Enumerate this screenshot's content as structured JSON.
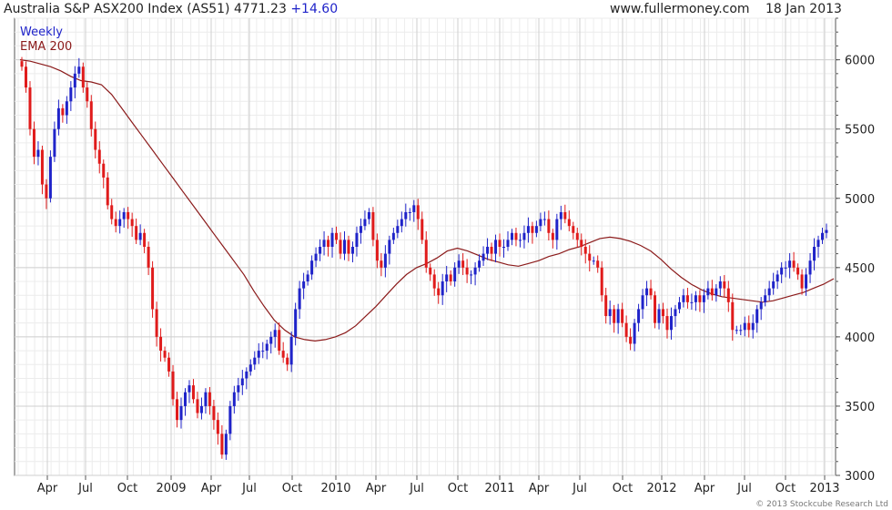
{
  "header": {
    "instrument": "Australia S&P ASX200 Index (AS51)",
    "last": "4771.23",
    "change": "+14.60",
    "site": "www.fullermoney.com",
    "date": "18 Jan 2013"
  },
  "copyright": "© 2013 Stockcube Research Ltd",
  "colors": {
    "up": "#1f23c9",
    "down": "#e01b1b",
    "ema": "#8b1a1a",
    "grid": "#cfcfcf",
    "change": "#1f23c9"
  },
  "chart_data": {
    "type": "candlestick",
    "period": "Weekly",
    "title": "Australia S&P ASX200 Index (AS51)",
    "ylim": [
      3000,
      6300
    ],
    "y_ticks": [
      3000,
      3500,
      4000,
      4500,
      5000,
      5500,
      6000
    ],
    "x_ticks": [
      "Apr",
      "Jul",
      "Oct",
      "2009",
      "Apr",
      "Jul",
      "Oct",
      "2010",
      "Apr",
      "Jul",
      "Oct",
      "2011",
      "Apr",
      "Jul",
      "Oct",
      "2012",
      "Apr",
      "Jul",
      "Oct",
      "2013"
    ],
    "legend": [
      {
        "label": "Weekly",
        "color": "#1f23c9"
      },
      {
        "label": "EMA 200",
        "color": "#8b1a1a"
      }
    ],
    "close": [
      5950,
      5800,
      5500,
      5300,
      5350,
      5100,
      5000,
      5300,
      5500,
      5650,
      5600,
      5700,
      5800,
      5900,
      5950,
      5800,
      5700,
      5500,
      5350,
      5250,
      5150,
      4950,
      4850,
      4800,
      4850,
      4900,
      4850,
      4800,
      4700,
      4750,
      4650,
      4500,
      4200,
      4000,
      3900,
      3850,
      3750,
      3550,
      3400,
      3500,
      3600,
      3650,
      3550,
      3450,
      3500,
      3600,
      3500,
      3400,
      3300,
      3150,
      3300,
      3500,
      3600,
      3650,
      3700,
      3750,
      3800,
      3850,
      3900,
      3900,
      3950,
      4000,
      4050,
      3900,
      3850,
      3800,
      4000,
      4200,
      4350,
      4400,
      4450,
      4550,
      4600,
      4650,
      4700,
      4650,
      4750,
      4700,
      4600,
      4700,
      4600,
      4650,
      4750,
      4800,
      4850,
      4900,
      4700,
      4550,
      4500,
      4600,
      4700,
      4750,
      4800,
      4850,
      4900,
      4900,
      4950,
      4850,
      4700,
      4500,
      4450,
      4350,
      4300,
      4400,
      4450,
      4400,
      4500,
      4550,
      4500,
      4450,
      4450,
      4500,
      4550,
      4600,
      4650,
      4600,
      4700,
      4650,
      4650,
      4700,
      4750,
      4700,
      4700,
      4750,
      4800,
      4750,
      4800,
      4850,
      4850,
      4750,
      4700,
      4850,
      4900,
      4850,
      4800,
      4750,
      4700,
      4650,
      4600,
      4550,
      4550,
      4500,
      4300,
      4150,
      4200,
      4100,
      4200,
      4100,
      4000,
      3950,
      4100,
      4200,
      4300,
      4350,
      4300,
      4100,
      4200,
      4150,
      4050,
      4150,
      4200,
      4250,
      4300,
      4250,
      4250,
      4300,
      4250,
      4300,
      4350,
      4300,
      4350,
      4400,
      4350,
      4250,
      4050,
      4050,
      4050,
      4100,
      4050,
      4100,
      4200,
      4250,
      4300,
      4350,
      4400,
      4450,
      4500,
      4500,
      4550,
      4500,
      4450,
      4350,
      4450,
      4550,
      4650,
      4700,
      4750,
      4771.23
    ],
    "ema200": [
      6000,
      5990,
      5970,
      5950,
      5920,
      5880,
      5850,
      5840,
      5820,
      5750,
      5650,
      5550,
      5450,
      5350,
      5250,
      5150,
      5050,
      4950,
      4850,
      4750,
      4650,
      4550,
      4450,
      4330,
      4220,
      4120,
      4050,
      4000,
      3980,
      3970,
      3980,
      4000,
      4030,
      4080,
      4150,
      4220,
      4300,
      4380,
      4450,
      4500,
      4530,
      4570,
      4620,
      4640,
      4620,
      4590,
      4560,
      4540,
      4520,
      4510,
      4530,
      4550,
      4580,
      4600,
      4630,
      4650,
      4680,
      4710,
      4720,
      4710,
      4690,
      4660,
      4620,
      4560,
      4490,
      4430,
      4380,
      4340,
      4310,
      4290,
      4280,
      4270,
      4260,
      4250,
      4260,
      4280,
      4300,
      4320,
      4350,
      4380,
      4420
    ]
  }
}
